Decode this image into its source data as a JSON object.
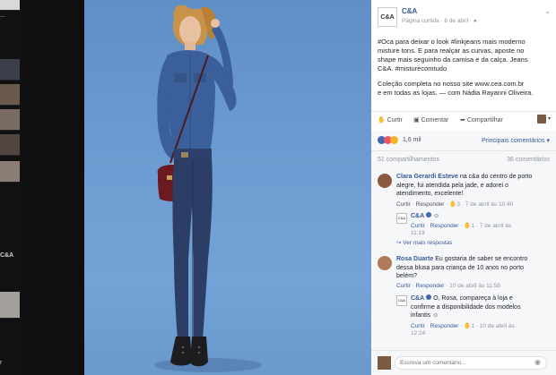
{
  "left_strip": {
    "label1": "...",
    "label2": "C&A",
    "label3": "r"
  },
  "post": {
    "page_name": "C&A",
    "meta_prefix": "Página curtida · 8 de abril ·",
    "caption_1": "#Oca para deixar o look #linkjeans mais moderno",
    "caption_2": "misture tons. E para realçar as curvas, aposte no",
    "caption_3": "shape mais seguinho da camisa e da calça. Jeans",
    "caption_4": "C&A. #misturecomtudo",
    "caption_5": "Coleção completa no nosso site www.cea.com.br",
    "caption_6": "e em todas as lojas. — com Nádia Rayanni Oliveira."
  },
  "actions": {
    "like": "Curtir",
    "comment": "Comentar",
    "share": "Compartilhar"
  },
  "reactions": {
    "count": "1,6 mil",
    "top_comments": "Principais comentários ▾"
  },
  "stats": {
    "shares": "51 compartilhamentos",
    "comments": "36 comentários"
  },
  "comments": [
    {
      "author": "Clara Gerardi Esteve",
      "line1": "na c&a do centro de porto",
      "line2": "alegre, fui atendida pela jade, e adorei o",
      "line3": "atendimento, excelente!",
      "like": "Curtir",
      "reply": "Responder",
      "likes": "3",
      "time": "7 de abril às 10:40"
    },
    {
      "author": "C&A",
      "line1": "",
      "like": "Curtir",
      "reply": "Responder",
      "likes": "1",
      "time": "7 de abril às",
      "time2": "11:19"
    },
    {
      "author": "Rosa Duarte",
      "line1": "Eu gostaria de saber se encontro",
      "line2": "dessa blusa para criança de 10 anos no porto",
      "line3": "belém?",
      "like": "Curtir",
      "reply": "Responder",
      "time": "10 de abril às 11:58"
    },
    {
      "author": "C&A",
      "line1": "O, Rosa, compareça à loja e",
      "line2": "confirme a disponibilidade dos modelos",
      "line3": "infantis",
      "like": "Curtir",
      "reply": "Responder",
      "likes": "1",
      "time": "10 de abril às",
      "time2": "12:24"
    }
  ],
  "more_replies": "Ver mais respostas",
  "composer": {
    "placeholder": "Escreva um comentário..."
  },
  "colors": {
    "link": "#365899",
    "muted": "#90949c",
    "photo_bg": "#6b9bd0",
    "denim_shirt": "#3b5f9a",
    "jeans": "#2c3d66",
    "bag": "#6b1a1f"
  }
}
